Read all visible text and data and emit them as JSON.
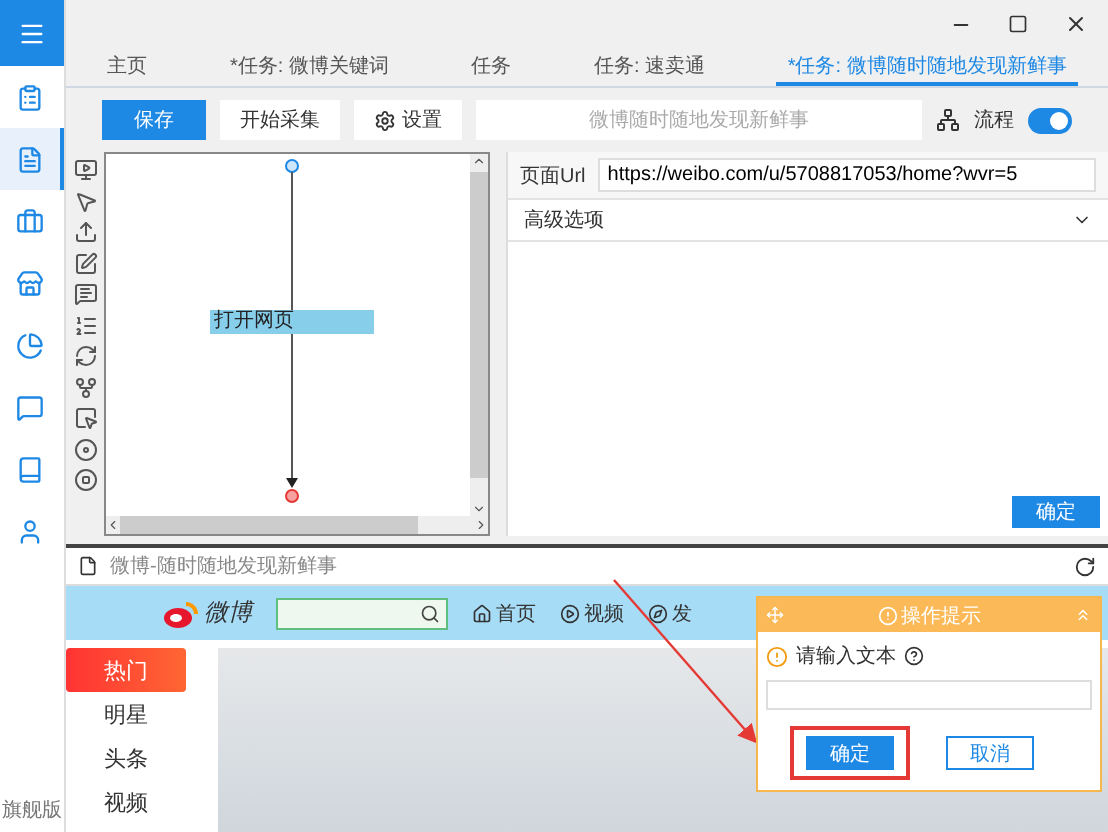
{
  "sidebar": {
    "items": [
      {
        "selected": false
      },
      {
        "selected": true
      },
      {
        "selected": false
      },
      {
        "selected": false
      },
      {
        "selected": false
      },
      {
        "selected": false
      },
      {
        "selected": false
      },
      {
        "selected": false
      }
    ],
    "edition": "旗舰版"
  },
  "tabs": [
    {
      "label": "主页",
      "selected": false
    },
    {
      "label": "*任务: 微博关键词",
      "selected": false
    },
    {
      "label": "任务",
      "selected": false
    },
    {
      "label": "任务: 速卖通",
      "selected": false
    },
    {
      "label": "*任务: 微博随时随地发现新鲜事",
      "selected": true
    }
  ],
  "toolbar": {
    "save": "保存",
    "start": "开始采集",
    "settings": "设置",
    "task_placeholder": "微博随时随地发现新鲜事",
    "flow_label": "流程",
    "flow_on": true
  },
  "canvas": {
    "nodes": [
      {
        "label": "打开网页"
      }
    ]
  },
  "properties": {
    "url_label": "页面Url",
    "url_value": "https://weibo.com/u/5708817053/home?wvr=5",
    "advanced": {
      "label": "高级选项",
      "expanded": false
    },
    "confirm": "确定"
  },
  "browser": {
    "page_title": "微博-随时随地发现新鲜事",
    "logo_text": "微博",
    "nav": [
      "首页",
      "视频",
      "发"
    ],
    "categories": [
      {
        "label": "热门",
        "selected": true
      },
      {
        "label": "明星",
        "selected": false
      },
      {
        "label": "头条",
        "selected": false
      },
      {
        "label": "视频",
        "selected": false
      }
    ]
  },
  "dialog": {
    "title": "操作提示",
    "prompt": "请输入文本",
    "buttons": [
      {
        "label": "确定",
        "kind": "primary",
        "highlighted": true
      },
      {
        "label": "取消",
        "kind": "secondary",
        "highlighted": false
      }
    ]
  }
}
